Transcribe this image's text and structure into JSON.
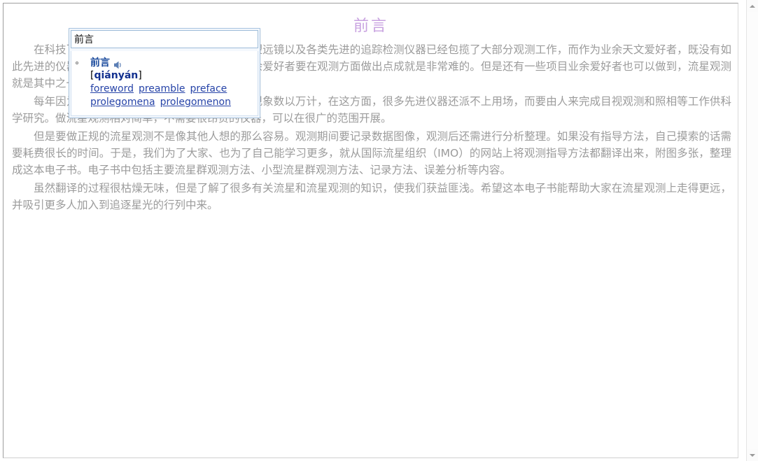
{
  "document": {
    "title": "前言",
    "title_color": "#c8a2e0",
    "text_color": "#9b9b9b",
    "paragraphs": [
      "在科技飞速发展的今天，天文观测方面，大型望远镜以及各类先进的追踪检测仪器已经包揽了大部分观测工作，而作为业余天文爱好者，既没有如此先进的仪器，也没有如此多的观测时间，因此业余爱好者要在观测方面做出点成就是非常难的。但是还有一些项目业余爱好者也可以做到，流星观测就是其中之一。",
      "每年因为流星体坠入地球大气层而产生的流星现象数以万计，在这方面，很多先进仪器还派不上用场，而要由人来完成目视观测和照相等工作供科学研究。做流星观测相对简单，不需要很昂贵的仪器，可以在很广的范围开展。",
      "但是要做正规的流星观测不是像其他人想的那么容易。观测期间要记录数据图像，观测后还需进行分析整理。如果没有指导方法，自己摸索的话需要耗费很长的时间。于是，我们为了大家、也为了自己能学习更多，就从国际流星组织（IMO）的网站上将观测指导方法都翻译出来，附图多张，整理成这本电子书。电子书中包括主要流星群观测方法、小型流星群观测方法、记录方法、误差分析等内容。",
      "虽然翻译的过程很枯燥无味，但是了解了很多有关流星和流星观测的知识，使我们获益匪浅。希望这本电子书能帮助大家在流星观测上走得更远，并吸引更多人加入到追逐星光的行列中来。"
    ]
  },
  "popup": {
    "input_value": "前言",
    "input_placeholder": "",
    "entries": [
      {
        "word": "前言",
        "pinyin_open": "[",
        "pinyin": "qiányán",
        "pinyin_close": "]",
        "speaker_icon": "speaker-icon",
        "senses": [
          "foreword",
          "preamble",
          "preface",
          "prolegomena",
          "prolegomenon"
        ]
      }
    ],
    "link_color": "#2744a8",
    "word_color": "#1a4a9c",
    "pinyin_color": "#12308f",
    "border_color": "#a8c4e0"
  },
  "scrollbar": {
    "up_arrow": "arrow-up-icon",
    "down_arrow": "arrow-down-icon",
    "position": "top"
  }
}
